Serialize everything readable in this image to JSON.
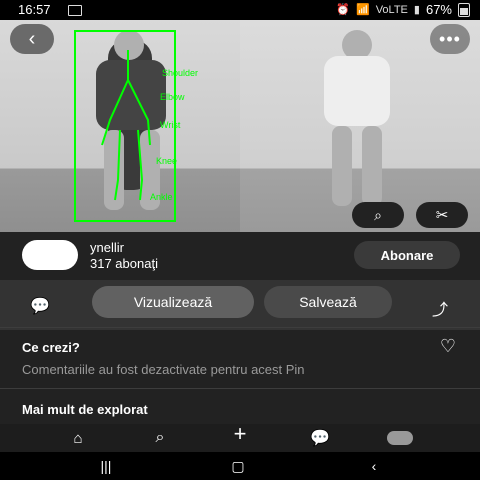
{
  "status_bar": {
    "time": "16:57",
    "battery": "67%",
    "carrier": "VoLTE"
  },
  "pose_labels": [
    "Shoulder",
    "Elbow",
    "Wrist",
    "Knee",
    "Ankle"
  ],
  "user": {
    "name": "ynellir",
    "followers": "317 abonaţi",
    "follow_label": "Abonare"
  },
  "actions": {
    "view_label": "Vizualizează",
    "save_label": "Salvează"
  },
  "comments": {
    "title": "Ce crezi?",
    "disabled_text": "Comentariile au fost dezactivate pentru acest Pin"
  },
  "explore": {
    "title": "Mai mult de explorat"
  },
  "icons": {
    "back": "chevron-left-icon",
    "more": "more-horizontal-icon",
    "lens": "visual-search-icon",
    "scissor": "scissors-icon",
    "comment": "comment-icon",
    "share": "share-icon",
    "heart": "heart-icon",
    "home": "home-icon",
    "search": "search-icon",
    "add": "plus-icon",
    "chat": "chat-icon",
    "profile": "profile-icon"
  },
  "colors": {
    "pose_overlay": "#00ff00",
    "sheet_bg": "#222222",
    "button_primary": "#616161"
  }
}
